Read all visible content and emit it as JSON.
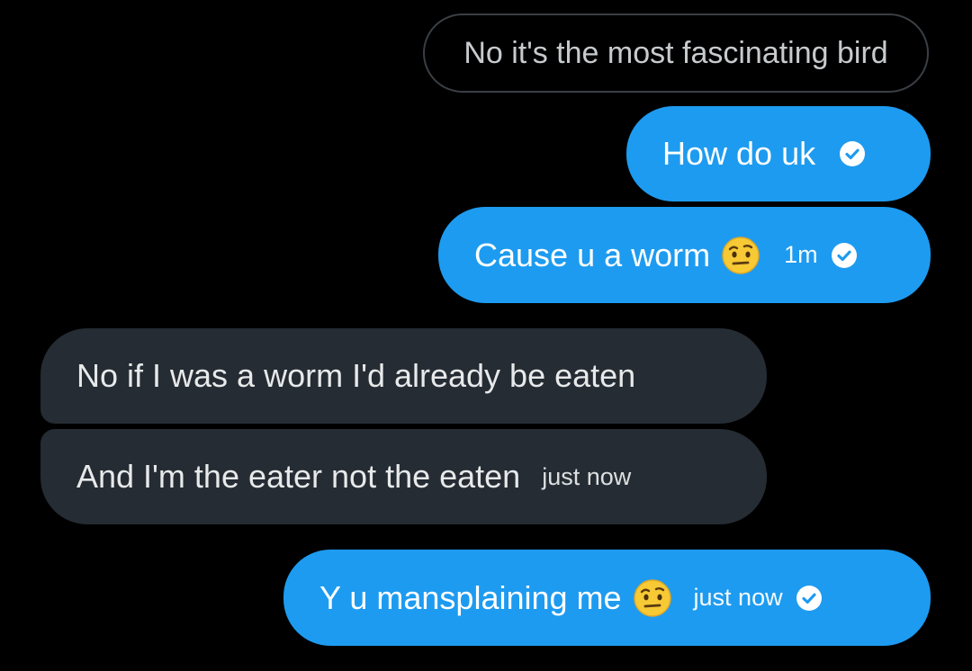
{
  "colors": {
    "background": "#000000",
    "sent_bubble": "#1d9bf0",
    "received_bubble": "#252c33",
    "quoted_border": "#3a3f44"
  },
  "conversation": {
    "top_fragment": "·  ·",
    "quoted_message": "No it's the most fascinating bird",
    "messages": [
      {
        "direction": "sent",
        "text": "How do uk",
        "time": "",
        "status_icon": "check-circle-icon"
      },
      {
        "direction": "sent",
        "text": "Cause u a worm",
        "emoji": "face-with-raised-eyebrow",
        "time": "1m",
        "status_icon": "check-circle-icon"
      },
      {
        "direction": "received",
        "text": "No if I was a worm I'd already be eaten",
        "time": ""
      },
      {
        "direction": "received",
        "text": "And I'm the eater not the eaten",
        "time": "just now"
      },
      {
        "direction": "sent",
        "text": "Y u mansplaining me",
        "emoji": "face-with-raised-eyebrow",
        "time": "just now",
        "status_icon": "check-circle-icon"
      }
    ]
  }
}
